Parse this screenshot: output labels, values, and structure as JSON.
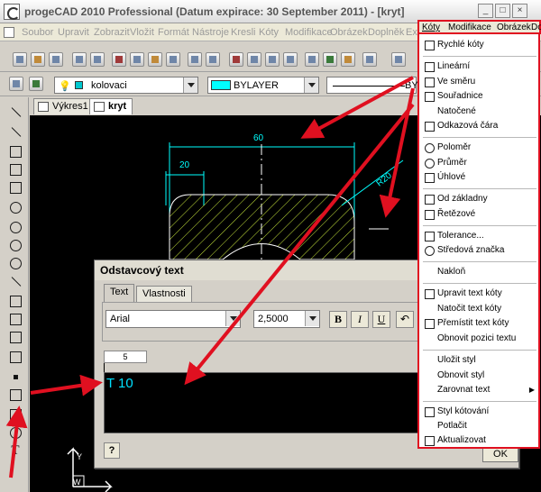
{
  "window": {
    "title": "progeCAD 2010 Professional  (Datum expirace: 30 September 2011) - [kryt]"
  },
  "menubar": [
    {
      "label": "Soubor"
    },
    {
      "label": "Upravit"
    },
    {
      "label": "Zobrazit"
    },
    {
      "label": "Vložit"
    },
    {
      "label": "Formát"
    },
    {
      "label": "Nástroje"
    },
    {
      "label": "Kresli"
    },
    {
      "label": "Kóty"
    },
    {
      "label": "Modifikace"
    },
    {
      "label": "Obrázek"
    },
    {
      "label": "Doplněk"
    },
    {
      "label": "Ex"
    },
    {
      "label": "Kóty",
      "active": true
    },
    {
      "label": "Modifikace",
      "active": true
    },
    {
      "label": "Obrázek",
      "active": true
    },
    {
      "label": "Do",
      "active": true
    }
  ],
  "properties_toolbar": {
    "layer": "kolovaci",
    "color": "BYLAYER",
    "linetype": "BY",
    "color_hex": "#00FFFF"
  },
  "doc_tabs": [
    {
      "label": "Výkres1"
    },
    {
      "label": "kryt",
      "active": true
    }
  ],
  "drawing": {
    "dim_overall": "60",
    "dim_partial": "20",
    "dim_radius": "R20"
  },
  "dialog": {
    "title": "Odstavcový text",
    "tabs": [
      {
        "label": "Text",
        "active": true
      },
      {
        "label": "Vlastnosti"
      }
    ],
    "font": "Arial",
    "height": "2,5000",
    "bold": "B",
    "italic": "I",
    "underline": "U",
    "undo": "↶",
    "ruler_value": "5",
    "text": "T 10",
    "help": "?",
    "ok": "OK"
  },
  "ucs": {
    "y": "Y",
    "w": "W"
  },
  "koty_menu": {
    "items": [
      {
        "label": "Rychlé kóty"
      },
      {
        "label": "Lineární"
      },
      {
        "label": "Ve směru"
      },
      {
        "label": "Souřadnice"
      },
      {
        "label": "Natočené"
      },
      {
        "label": "Odkazová čára"
      },
      {
        "label": "Poloměr"
      },
      {
        "label": "Průměr"
      },
      {
        "label": "Úhlové"
      },
      {
        "label": "Od základny"
      },
      {
        "label": "Řetězové"
      },
      {
        "label": "Tolerance..."
      },
      {
        "label": "Středová značka"
      },
      {
        "label": "Nakloň"
      },
      {
        "label": "Upravit text kóty"
      },
      {
        "label": "Natočit text kóty"
      },
      {
        "label": "Přemístit text kóty"
      },
      {
        "label": "Obnovit pozici textu"
      },
      {
        "label": "Uložit styl"
      },
      {
        "label": "Obnovit styl"
      },
      {
        "label": "Zarovnat text",
        "submenu_arrow": "▶"
      },
      {
        "label": "Styl kótování"
      },
      {
        "label": "Potlačit"
      },
      {
        "label": "Aktualizovat"
      }
    ]
  },
  "accent_colors": {
    "highlight": "#E01020",
    "dimension": "#00FFFF",
    "hatch": "#C8E63C"
  }
}
